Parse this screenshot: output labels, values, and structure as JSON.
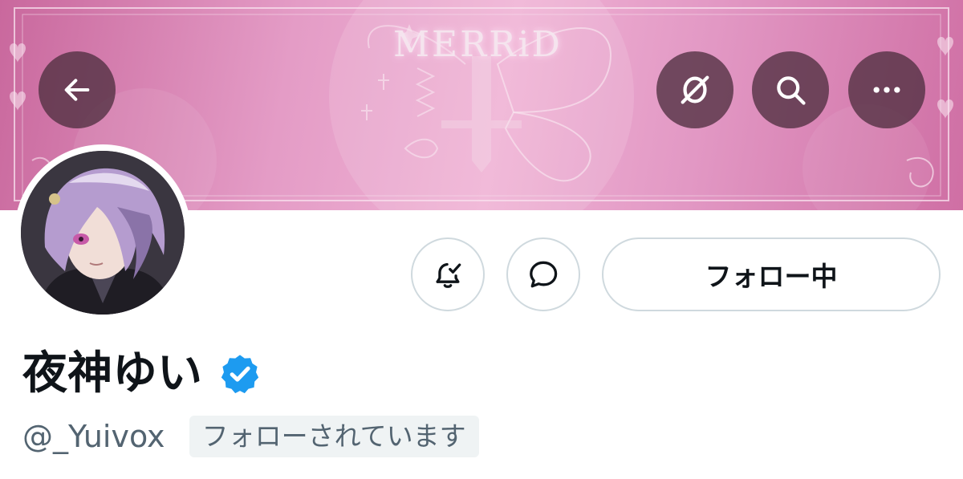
{
  "banner": {
    "logo_text": "MERRiD",
    "background_color": "#e7a3c9"
  },
  "overlay_buttons": {
    "back_icon": "arrow-left-icon",
    "translate_icon": "translate-icon",
    "search_icon": "search-icon",
    "more_icon": "more-horizontal-icon"
  },
  "actions": {
    "notifications_icon": "bell-check-icon",
    "message_icon": "chat-bubble-icon",
    "follow_label": "フォロー中"
  },
  "profile": {
    "display_name": "夜神ゆい",
    "verified": true,
    "verified_color": "#1d9bf0",
    "handle": "@_Yuivox",
    "follows_you_label": "フォローされています"
  },
  "colors": {
    "text_primary": "#0f1419",
    "text_secondary": "#536471",
    "border": "#cfd9de",
    "badge_bg": "#eff3f4"
  }
}
